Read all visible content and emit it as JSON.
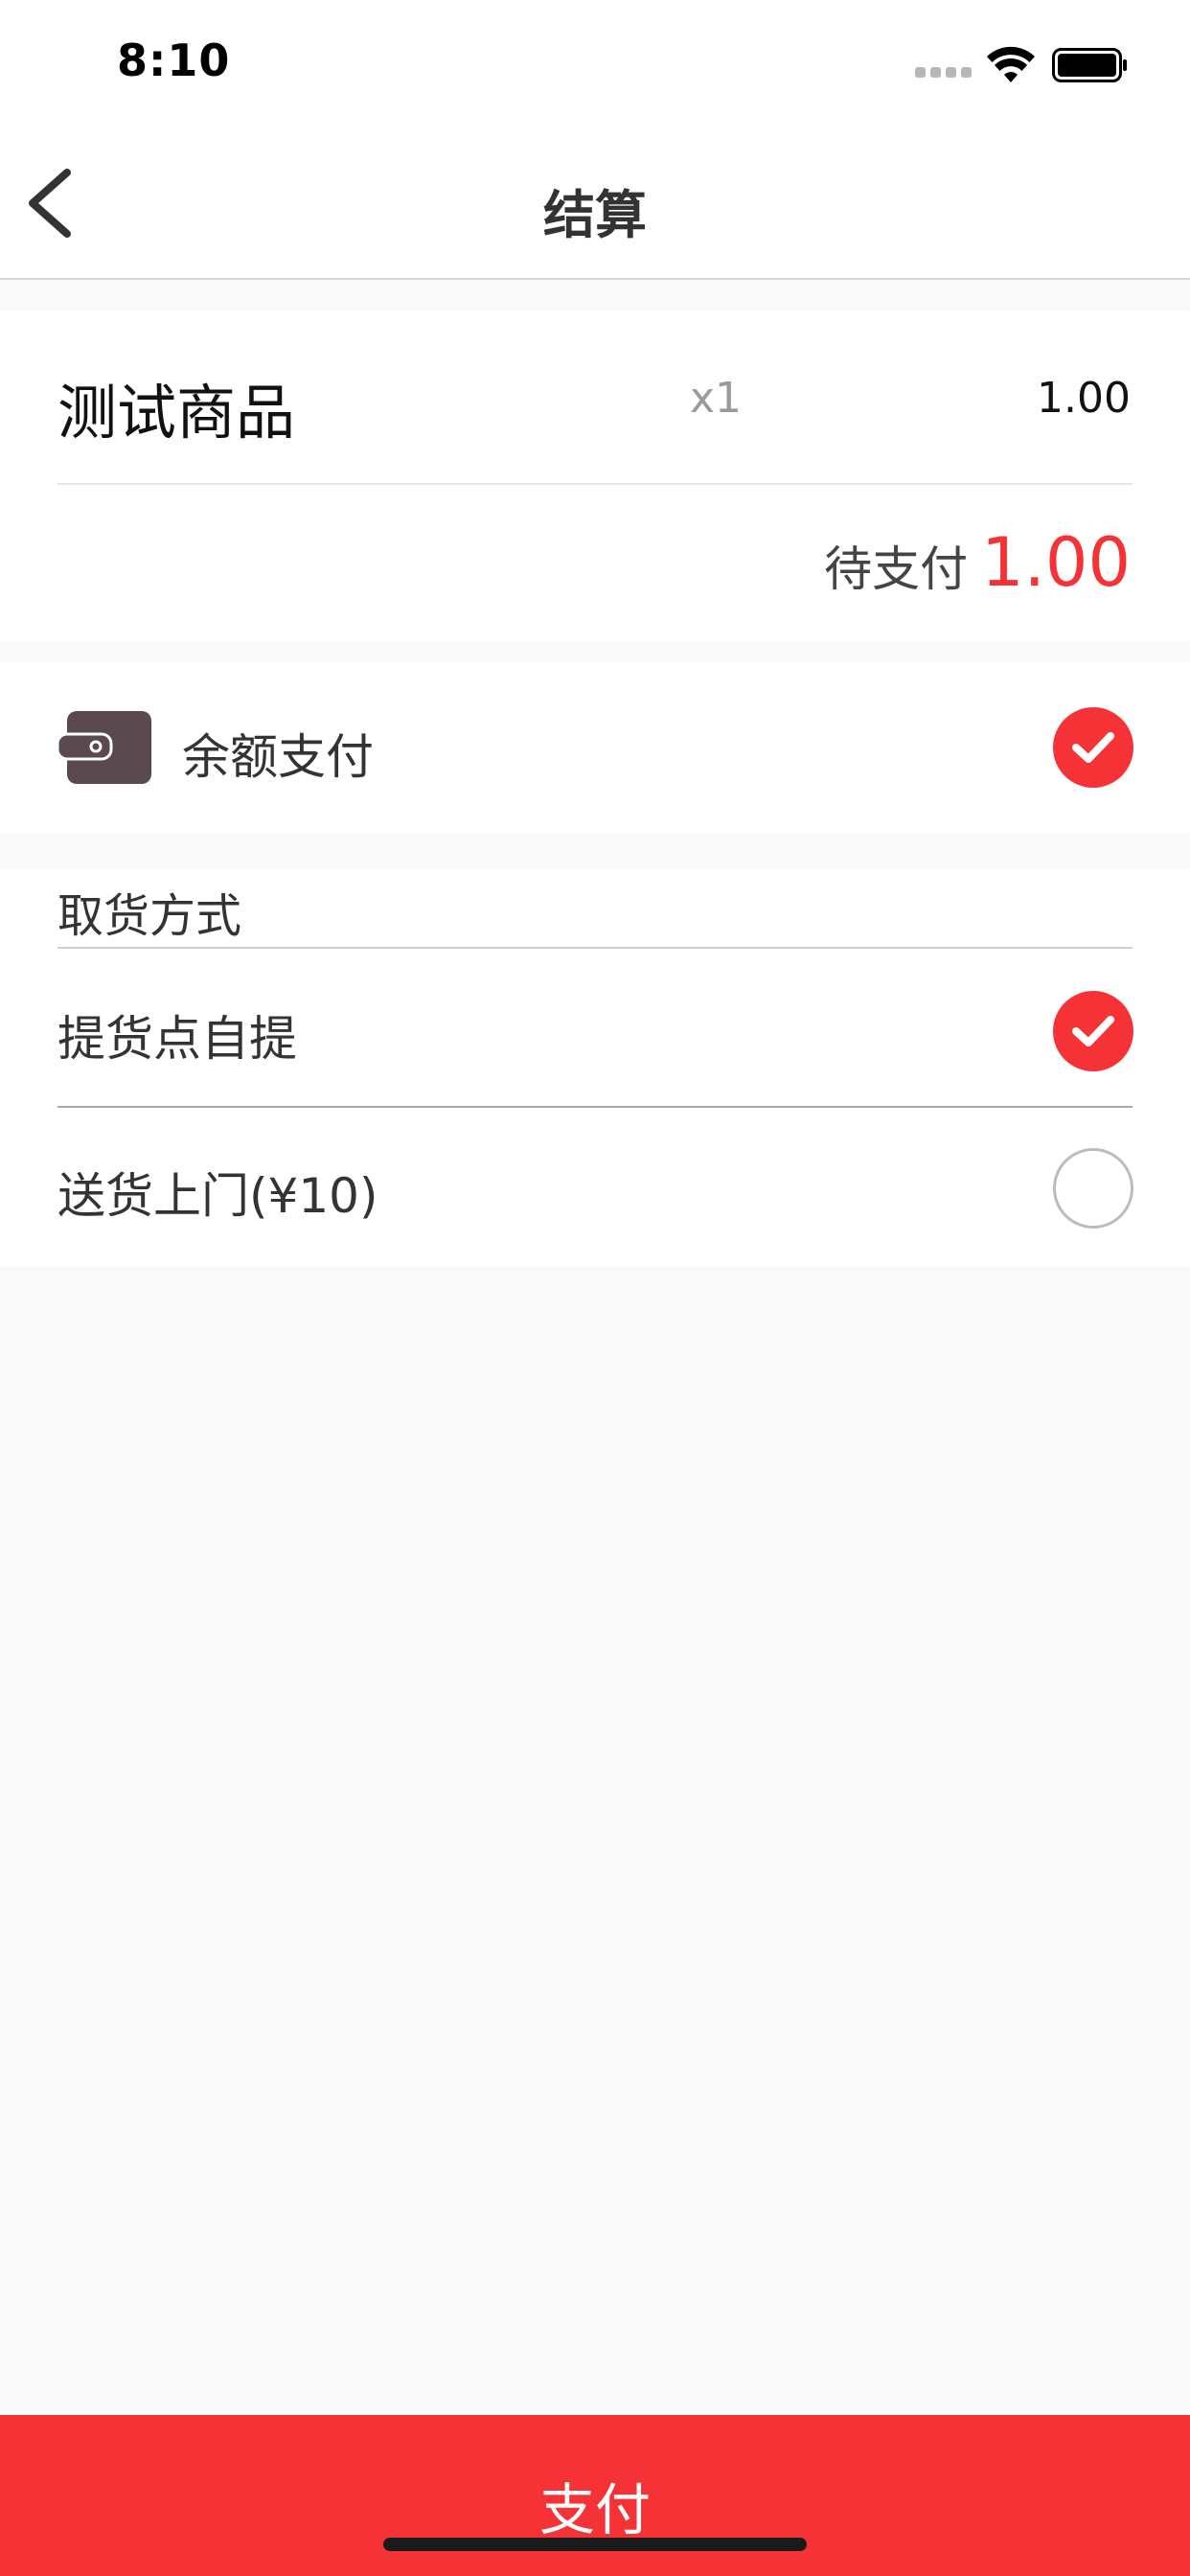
{
  "status_bar": {
    "time": "8:10"
  },
  "nav": {
    "title": "结算"
  },
  "order": {
    "product_name": "测试商品",
    "quantity": "x1",
    "price": "1.00",
    "due_label": "待支付",
    "due_amount": "1.00"
  },
  "payment": {
    "method_label": "余额支付",
    "selected": true
  },
  "pickup": {
    "header": "取货方式",
    "options": [
      {
        "label": "提货点自提",
        "selected": true
      },
      {
        "label": "送货上门(¥10)",
        "selected": false
      }
    ]
  },
  "footer": {
    "pay_label": "支付"
  },
  "colors": {
    "accent": "#f53337",
    "background": "#f9f9f9",
    "wallet": "#5a4a4f"
  },
  "icons": {
    "back": "chevron-left-icon",
    "wallet": "wallet-icon",
    "check": "check-circle-icon",
    "radio": "radio-empty-icon"
  }
}
